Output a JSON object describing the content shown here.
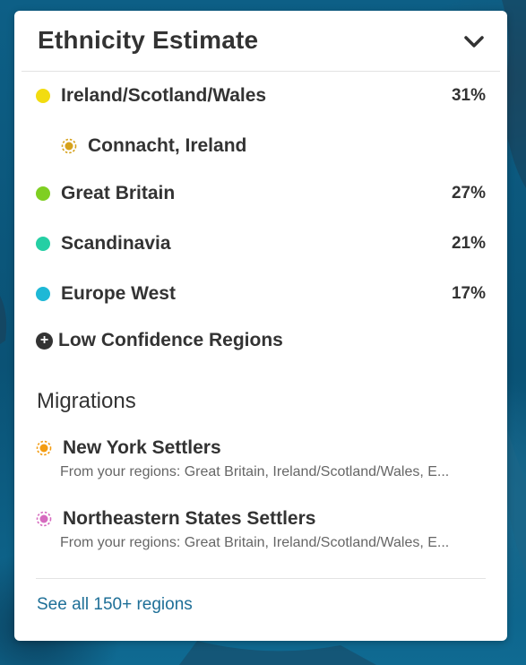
{
  "panel": {
    "title": "Ethnicity Estimate",
    "collapse_icon": "chevron-down-icon"
  },
  "regions": [
    {
      "name": "Ireland/Scotland/Wales",
      "percent": "31%",
      "color": "#f2dc10"
    },
    {
      "name": "Great Britain",
      "percent": "27%",
      "color": "#7fcf22"
    },
    {
      "name": "Scandinavia",
      "percent": "21%",
      "color": "#25cfa4"
    },
    {
      "name": "Europe West",
      "percent": "17%",
      "color": "#1eb8d6"
    }
  ],
  "subregion": {
    "name": "Connacht, Ireland",
    "color": "#d6a21c"
  },
  "low_confidence": {
    "label": "Low Confidence Regions",
    "icon": "plus-circle-icon"
  },
  "migrations": {
    "title": "Migrations",
    "items": [
      {
        "name": "New York Settlers",
        "detail": "From your regions: Great Britain, Ireland/Scotland/Wales, E...",
        "color": "#f39c12"
      },
      {
        "name": "Northeastern States Settlers",
        "detail": "From your regions: Great Britain, Ireland/Scotland/Wales, E...",
        "color": "#d66bbf"
      }
    ]
  },
  "footer": {
    "see_all": "See all 150+ regions"
  }
}
